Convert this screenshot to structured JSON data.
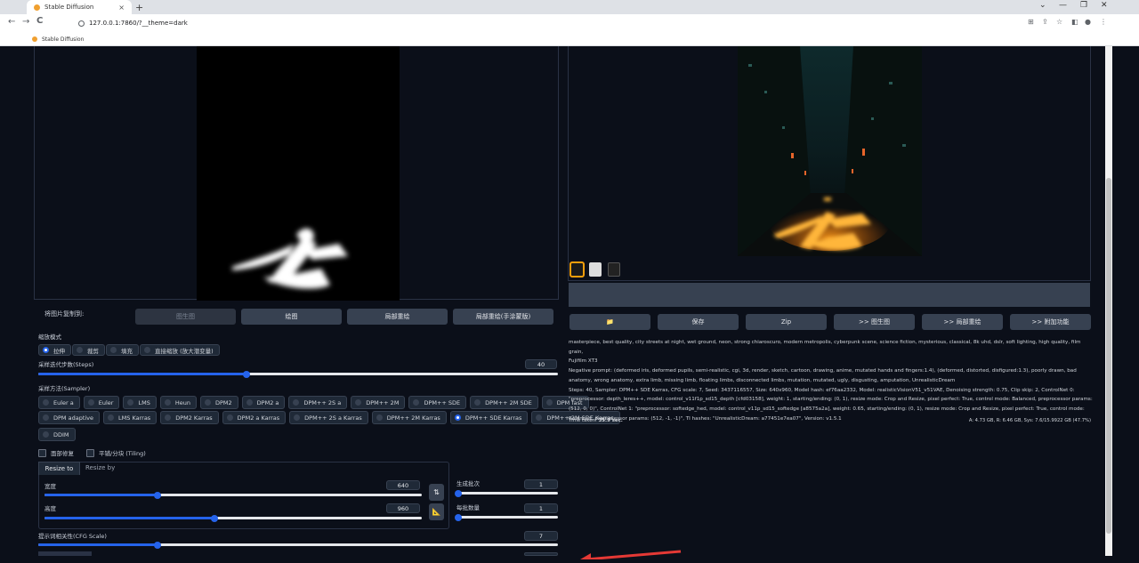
{
  "browser": {
    "tab_title": "Stable Diffusion",
    "tab_close": "×",
    "new_tab": "+",
    "url": "127.0.0.1:7860/?__theme=dark",
    "bookmark": "Stable Diffusion",
    "nav": {
      "back": "←",
      "forward": "→",
      "reload": "C"
    },
    "window": {
      "minimize": "—",
      "restore": "❐",
      "close": "✕",
      "chevron": "⌄"
    }
  },
  "left": {
    "send_label": "将图片复制到:",
    "send_buttons": [
      "图生图",
      "绘图",
      "局部重绘",
      "局部重绘(手涂蒙版)"
    ],
    "resize_mode_label": "缩放模式",
    "resize_modes": [
      "拉伸",
      "裁剪",
      "填充",
      "直接缩放 (放大潜变量)"
    ],
    "resize_mode_selected": 0,
    "steps_label": "采样迭代步数(Steps)",
    "steps_value": "40",
    "sampler_label": "采样方法(Sampler)",
    "samplers_row1": [
      "Euler a",
      "Euler",
      "LMS",
      "Heun",
      "DPM2",
      "DPM2 a",
      "DPM++ 2S a",
      "DPM++ 2M",
      "DPM++ SDE",
      "DPM++ 2M SDE",
      "DPM fast"
    ],
    "samplers_row2": [
      "DPM adaptive",
      "LMS Karras",
      "DPM2 Karras",
      "DPM2 a Karras",
      "DPM++ 2S a Karras",
      "DPM++ 2M Karras",
      "DPM++ SDE Karras",
      "DPM++ 2M SDE Karras"
    ],
    "samplers_row3": [
      "DDIM"
    ],
    "sampler_selected": "DPM++ SDE Karras",
    "face_restore": "面部修复",
    "tiling": "平铺/分块 (Tiling)",
    "resize_tabs": [
      "Resize to",
      "Resize by"
    ],
    "width_label": "宽度",
    "width_value": "640",
    "height_label": "高度",
    "height_value": "960",
    "batch_count_label": "生成批次",
    "batch_count_value": "1",
    "batch_size_label": "每批数量",
    "batch_size_value": "1",
    "cfg_label": "提示词相关性(CFG Scale)",
    "cfg_value": "7",
    "swap_icon": "⇅",
    "ratio_icon": "📐"
  },
  "right": {
    "buttons": [
      "📁",
      "保存",
      "Zip",
      ">> 图生图",
      ">> 局部重绘",
      ">> 附加功能"
    ],
    "info_lines": [
      "masterpiece, best quality, city streets at night, wet ground, neon, strong chiaroscuro, modern metropolis, cyberpunk scene, science fiction, mysterious, classical, 8k uhd, dslr, soft lighting, high quality, film grain,",
      "Fujifilm XT3",
      "Negative prompt: (deformed iris, deformed pupils, semi-realistic, cgi, 3d, render, sketch, cartoon, drawing, anime, mutated hands and fingers:1.4), (deformed, distorted, disfigured:1.3), poorly drawn, bad",
      "anatomy, wrong anatomy, extra limb, missing limb, floating limbs, disconnected limbs, mutation, mutated, ugly, disgusting, amputation, UnrealisticDream",
      "Steps: 40, Sampler: DPM++ SDE Karras, CFG scale: 7, Seed: 3437116557, Size: 640x960, Model hash: ef76aa2332, Model: realisticVisionV51_v51VAE, Denoising strength: 0.75, Clip skip: 2, ControlNet 0:",
      "\"preprocessor: depth_leres++, model: control_v11f1p_sd15_depth [cfd03158], weight: 1, starting/ending: (0, 1), resize mode: Crop and Resize, pixel perfect: True, control mode: Balanced, preprocessor params:",
      "(512, 0, 0)\", ControlNet 1: \"preprocessor: softedge_hed, model: control_v11p_sd15_softedge [a8575a2a], weight: 0.65, starting/ending: (0, 1), resize mode: Crop and Resize, pixel perfect: True, control mode:",
      "Balanced, preprocessor params: (512, -1, -1)\", TI hashes: \"UnrealisticDream: a77451e7ea07\", Version: v1.5.1"
    ],
    "time_taken_label": "Time taken:",
    "time_taken_value": "35.9 sec.",
    "vram_text": "A: 4.73 GB, R: 6.46 GB, Sys: 7.6/15.9922 GB (47.7%)"
  },
  "progress": {
    "steps": 0.4,
    "width": 0.3,
    "height": 0.45,
    "cfg": 0.23
  },
  "colors": {
    "bg": "#0b0f19",
    "button": "#374151",
    "accent": "#2563eb",
    "arrow": "#e53935"
  }
}
